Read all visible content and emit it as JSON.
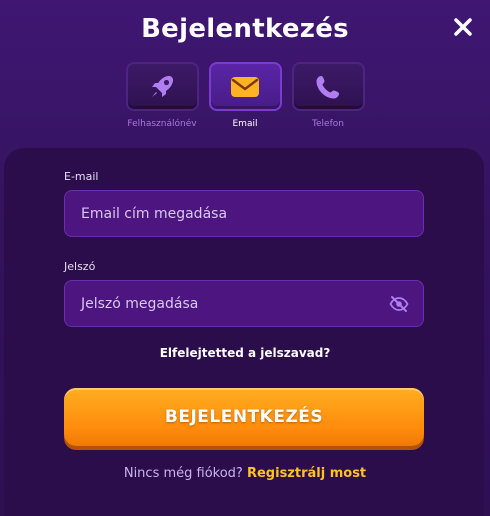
{
  "header": {
    "title": "Bejelentkezés"
  },
  "tabs": [
    {
      "label": "Felhasználónév",
      "icon": "rocket-icon",
      "active": false
    },
    {
      "label": "Email",
      "icon": "envelope-icon",
      "active": true
    },
    {
      "label": "Telefon",
      "icon": "phone-icon",
      "active": false
    }
  ],
  "form": {
    "email_label": "E-mail",
    "email_placeholder": "Email cím megadása",
    "password_label": "Jelszó",
    "password_placeholder": "Jelszó megadása",
    "forgot_link": "Elfelejtetted a jelszavad?",
    "login_button": "BEJELENTKEZÉS"
  },
  "footer": {
    "question": "Nincs még fiókod?",
    "signup_link": "Regisztrálj most"
  },
  "colors": {
    "background": "#35135f",
    "panel": "#2a0d4a",
    "input": "#4c1580",
    "accent_orange": "#ff8b0c",
    "link_yellow": "#ffc21e",
    "icon_purple": "#b07ef0",
    "email_icon": "#ffb224"
  }
}
